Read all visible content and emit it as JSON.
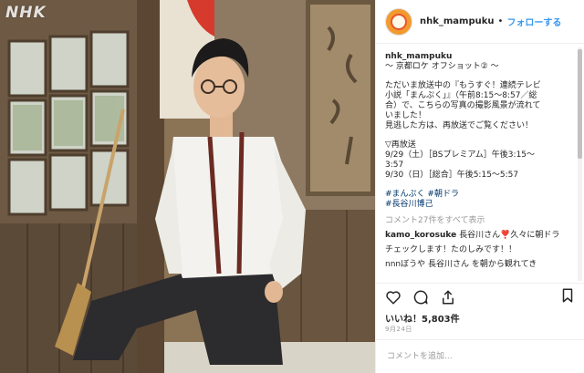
{
  "photo": {
    "watermark": "NHK"
  },
  "header": {
    "username": "nhk_mampuku",
    "separator": "•",
    "follow_label": "フォローする"
  },
  "caption": {
    "username": "nhk_mampuku",
    "lines": [
      "～ 京都ロケ オフショット② ～",
      "",
      "ただいま放送中の『もうすぐ！連続テレビ",
      "小説「まんぷく」』（午前8:15〜8:57／総",
      "合）で、こちらの写真の撮影風景が流れて",
      "いました！",
      "見逃した方は、再放送でご覧ください！",
      "",
      "▽再放送",
      "9/29（土）［BSプレミアム］午後3:15〜",
      "3:57",
      "9/30（日）［総合］午後5:15〜5:57",
      ""
    ],
    "hashtags_line1": "#まんぷく #朝ドラ",
    "hashtags_line2": "#長谷川博己"
  },
  "view_all_comments": "コメント27件をすべて表示",
  "comments": [
    {
      "user": "kamo_korosuke",
      "text": " 長谷川さん❣️久々に朝ドラ"
    },
    {
      "user": "",
      "text": "チェックします！たのしみです！！"
    },
    {
      "user": "",
      "text": "nnnぼうや 長谷川さん を朝から観れてき"
    }
  ],
  "actions": {
    "like_icon": "heart-icon",
    "comment_icon": "comment-icon",
    "share_icon": "share-icon",
    "bookmark_icon": "bookmark-icon"
  },
  "likes_text": "いいね！5,803件",
  "date_text": "9月24日",
  "comment_input": {
    "placeholder": "コメントを追加..."
  },
  "colors": {
    "link_blue": "#3897f0",
    "hashtag_blue": "#003569",
    "muted_gray": "#999999",
    "avatar_orange": "#f39a2f"
  }
}
